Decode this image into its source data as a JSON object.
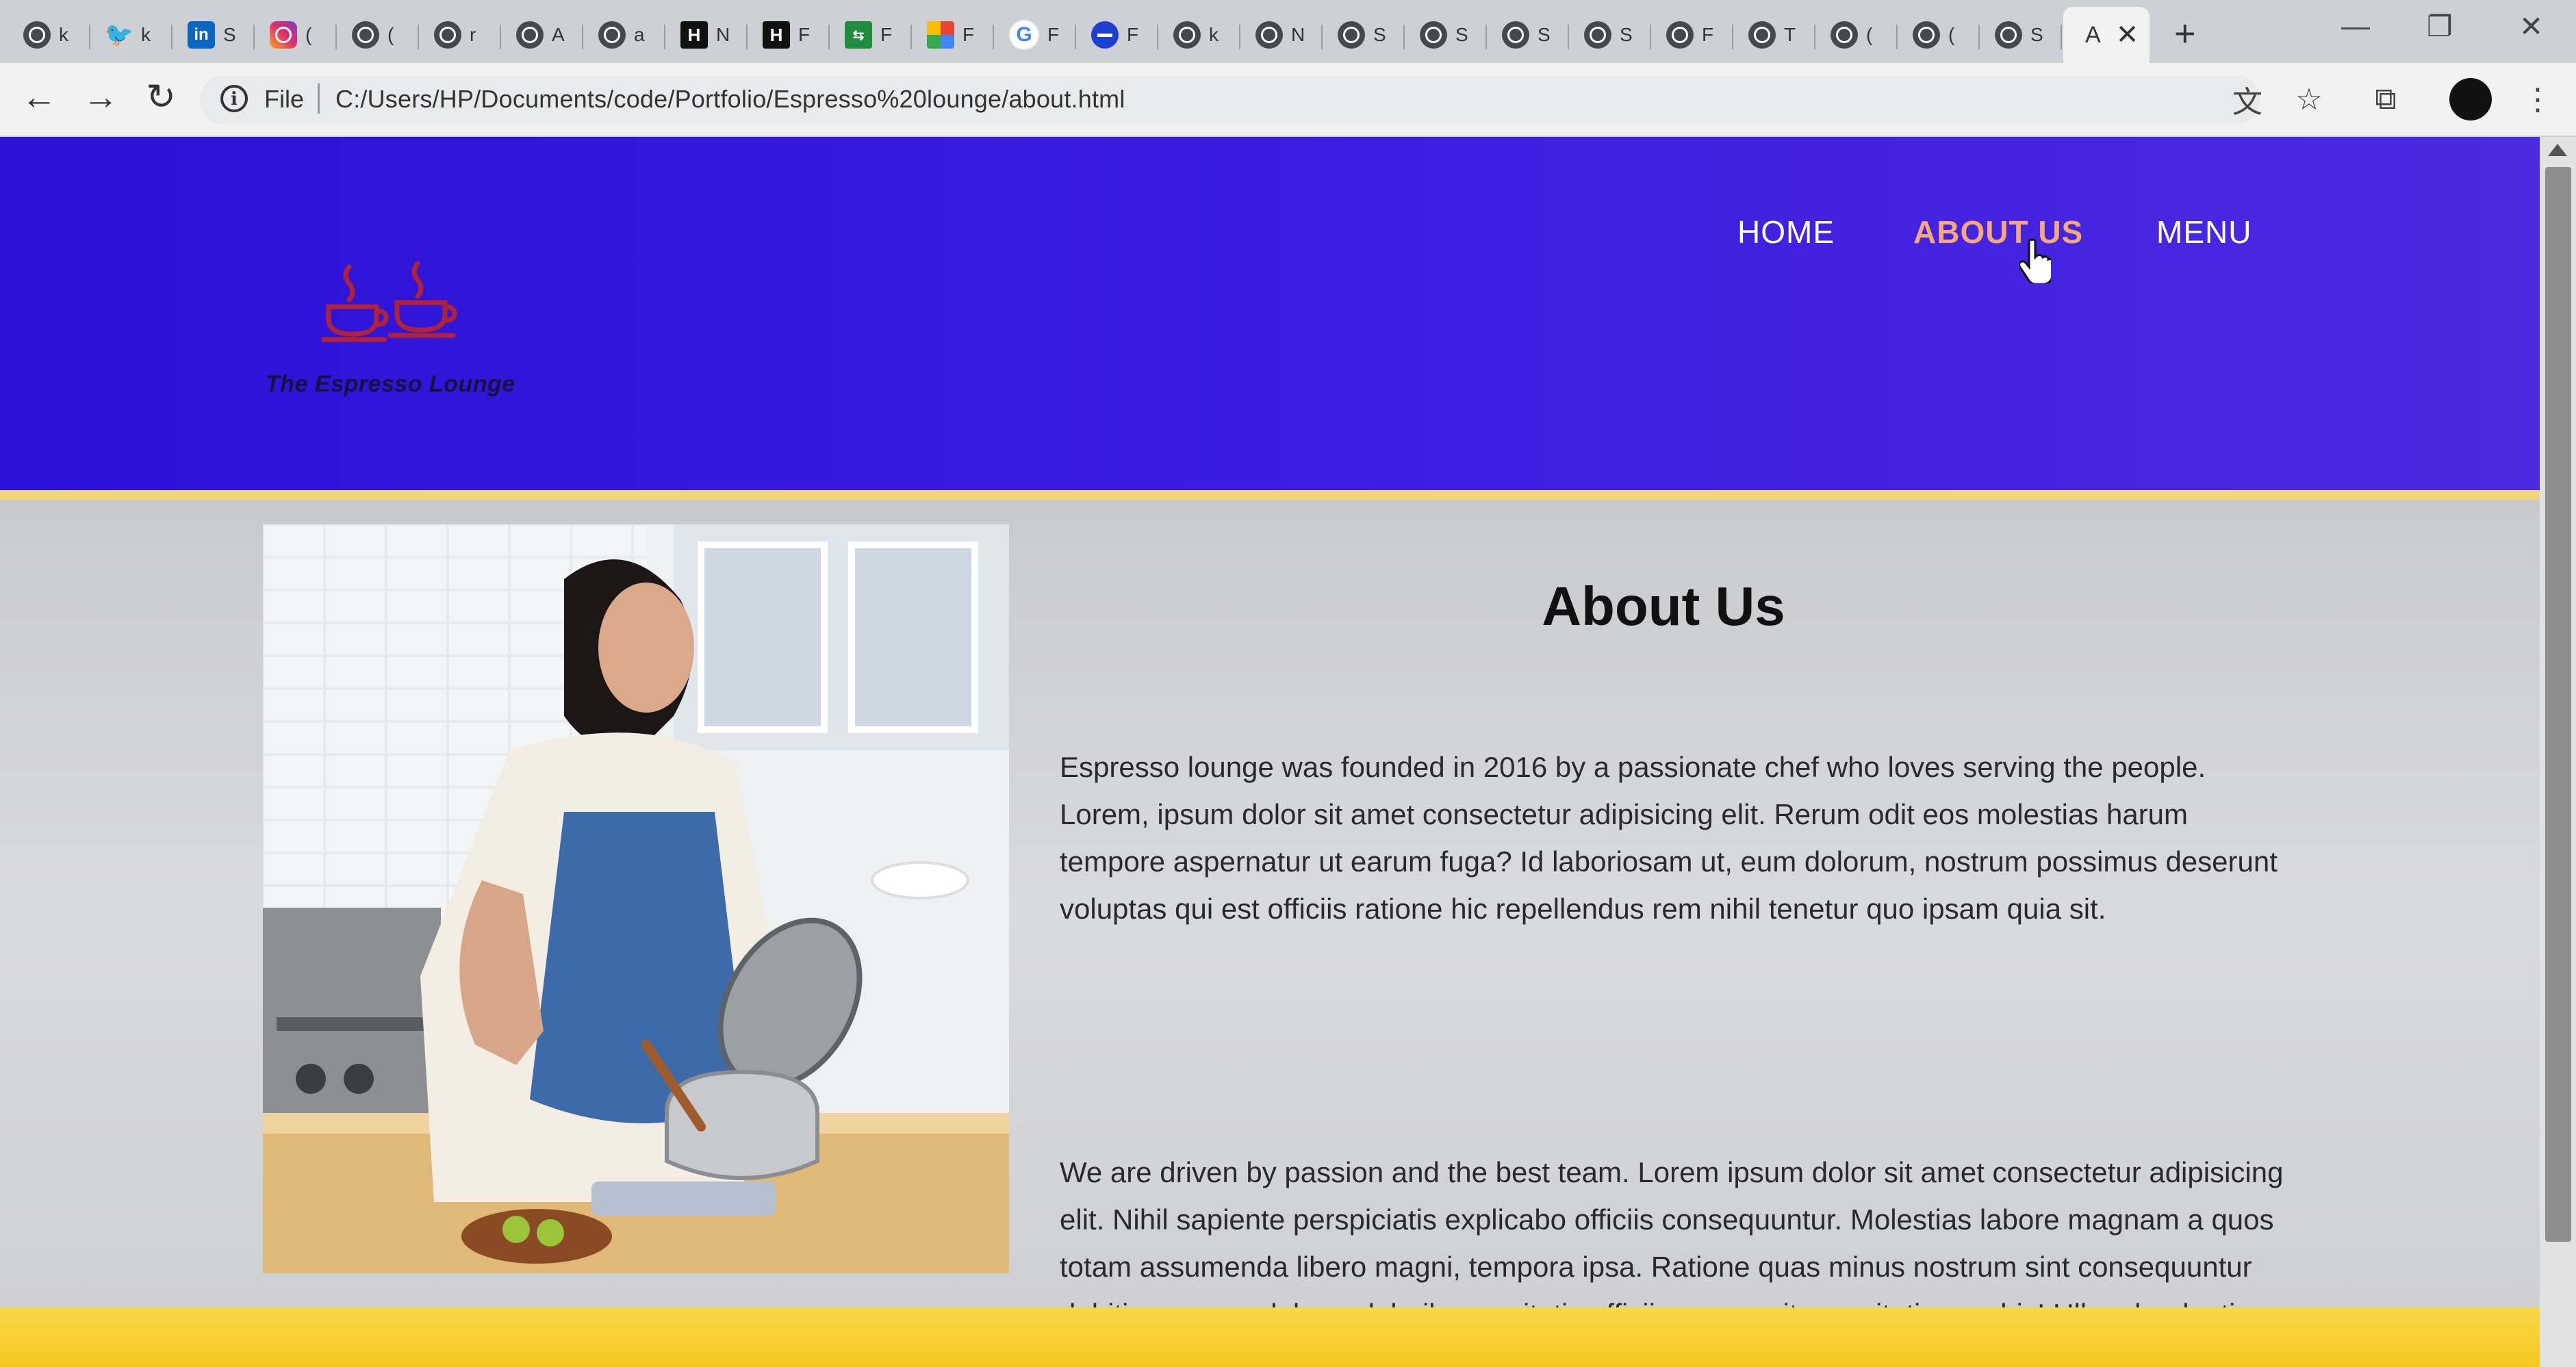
{
  "browser": {
    "tabs": [
      {
        "icon": "globe-icon",
        "glyph": "",
        "short": "k",
        "style": "globe"
      },
      {
        "icon": "twitter-icon",
        "glyph": "🐦",
        "short": "k",
        "style": "twitter"
      },
      {
        "icon": "linkedin-icon",
        "glyph": "in",
        "short": "S",
        "style": "linkedin"
      },
      {
        "icon": "instagram-icon",
        "glyph": "",
        "short": "(",
        "style": "instagram"
      },
      {
        "icon": "globe-icon",
        "glyph": "",
        "short": "(",
        "style": "globe"
      },
      {
        "icon": "globe-icon",
        "glyph": "",
        "short": "r",
        "style": "globe"
      },
      {
        "icon": "globe-icon",
        "glyph": "",
        "short": "A",
        "style": "globe"
      },
      {
        "icon": "globe-icon",
        "glyph": "",
        "short": "a",
        "style": "globe"
      },
      {
        "icon": "hashnode-icon",
        "glyph": "H",
        "short": "N",
        "style": "hbox"
      },
      {
        "icon": "hashnode-icon",
        "glyph": "H",
        "short": "F",
        "style": "hbox"
      },
      {
        "icon": "spreadsheet-icon",
        "glyph": "⇆",
        "short": "F",
        "style": "sheet"
      },
      {
        "icon": "grid-icon",
        "glyph": "",
        "short": "F",
        "style": "grid"
      },
      {
        "icon": "google-icon",
        "glyph": "G",
        "short": "F",
        "style": "google"
      },
      {
        "icon": "blue-circle-icon",
        "glyph": "",
        "short": "F",
        "style": "blue"
      },
      {
        "icon": "globe-icon",
        "glyph": "",
        "short": "k",
        "style": "globe"
      },
      {
        "icon": "globe-icon",
        "glyph": "",
        "short": "N",
        "style": "globe"
      },
      {
        "icon": "globe-icon",
        "glyph": "",
        "short": "S",
        "style": "globe"
      },
      {
        "icon": "globe-icon",
        "glyph": "",
        "short": "S",
        "style": "globe"
      },
      {
        "icon": "globe-icon",
        "glyph": "",
        "short": "S",
        "style": "globe"
      },
      {
        "icon": "globe-icon",
        "glyph": "",
        "short": "S",
        "style": "globe"
      },
      {
        "icon": "globe-icon",
        "glyph": "",
        "short": "F",
        "style": "globe"
      },
      {
        "icon": "globe-icon",
        "glyph": "",
        "short": "T",
        "style": "globe"
      },
      {
        "icon": "globe-icon",
        "glyph": "",
        "short": "(",
        "style": "globe"
      },
      {
        "icon": "globe-icon",
        "glyph": "",
        "short": "(",
        "style": "globe"
      },
      {
        "icon": "globe-icon",
        "glyph": "",
        "short": "S",
        "style": "globe"
      }
    ],
    "active_tab": {
      "title": "A",
      "close_glyph": "✕"
    },
    "new_tab_glyph": "+",
    "window_controls": {
      "minimize": "—",
      "restore": "❐",
      "close": "✕"
    },
    "back_glyph": "←",
    "forward_glyph": "→",
    "reload_glyph": "↻",
    "info_glyph": "i",
    "file_label": "File",
    "url": "C:/Users/HP/Documents/code/Portfolio/Espresso%20lounge/about.html",
    "translate_glyph": "文",
    "star_glyph": "☆",
    "cast_glyph": "⧉",
    "menu_glyph": "⋮"
  },
  "site": {
    "logo_text": "The Espresso Lounge",
    "nav": [
      {
        "label": "HOME",
        "active": false
      },
      {
        "label": "ABOUT US",
        "active": true
      },
      {
        "label": "MENU",
        "active": false
      }
    ],
    "about": {
      "title": "About Us",
      "paragraph1": "Espresso lounge was founded in 2016 by a passionate chef who loves serving the people. Lorem, ipsum dolor sit amet consectetur adipisicing elit. Rerum odit eos molestias harum tempore aspernatur ut earum fuga? Id laboriosam ut, eum dolorum, nostrum possimus deserunt voluptas qui est officiis ratione hic repellendus rem nihil tenetur quo ipsam quia sit.",
      "paragraph2": "We are driven by passion and the best team. Lorem ipsum dolor sit amet consectetur adipisicing elit. Nihil sapiente perspiciatis explicabo officiis consequuntur. Molestias labore magnam a quos totam assumenda libero magni, tempora ipsa. Ratione quas minus nostrum sint consequuntur debitis magnam labore doloribus veritatis officiis rerum, sit exercitationem hic! Ullam laudantium qui illo id voluptatem sint delectus iste."
    }
  },
  "colors": {
    "header_blue": "#2a12d6",
    "nav_active": "#f7a878",
    "footer_yellow": "#f5c61a",
    "logo_red": "#b0213a"
  }
}
